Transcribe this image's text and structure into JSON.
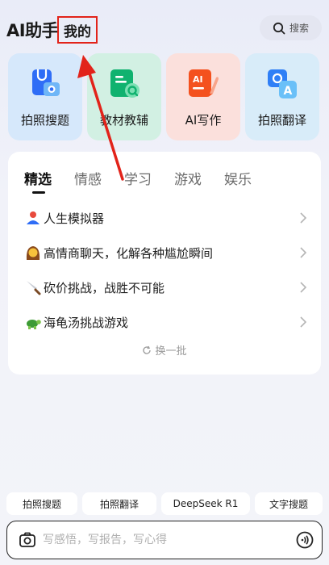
{
  "header": {
    "title": "AI助手",
    "mine_tab": "我的",
    "search_label": "搜索"
  },
  "tiles": [
    {
      "label": "拍照搜题",
      "icon": "photo-search-icon"
    },
    {
      "label": "教材教辅",
      "icon": "textbook-icon"
    },
    {
      "label": "AI写作",
      "icon": "ai-writing-icon"
    },
    {
      "label": "拍照翻译",
      "icon": "photo-translate-icon"
    }
  ],
  "categories": [
    "精选",
    "情感",
    "学习",
    "游戏",
    "娱乐"
  ],
  "active_category": "精选",
  "list": [
    {
      "text": "人生模拟器",
      "icon": "person-icon"
    },
    {
      "text": "高情商聊天，化解各种尴尬瞬间",
      "icon": "woman-icon"
    },
    {
      "text": "砍价挑战，战胜不可能",
      "icon": "knife-icon"
    },
    {
      "text": "海龟汤挑战游戏",
      "icon": "turtle-icon"
    }
  ],
  "refresh_label": "换一批",
  "shortcuts": [
    "拍照搜题",
    "拍照翻译",
    "DeepSeek R1",
    "文字搜题"
  ],
  "input": {
    "placeholder": "写感悟，写报告，写心得"
  },
  "colors": {
    "annotation": "#e2231a"
  }
}
